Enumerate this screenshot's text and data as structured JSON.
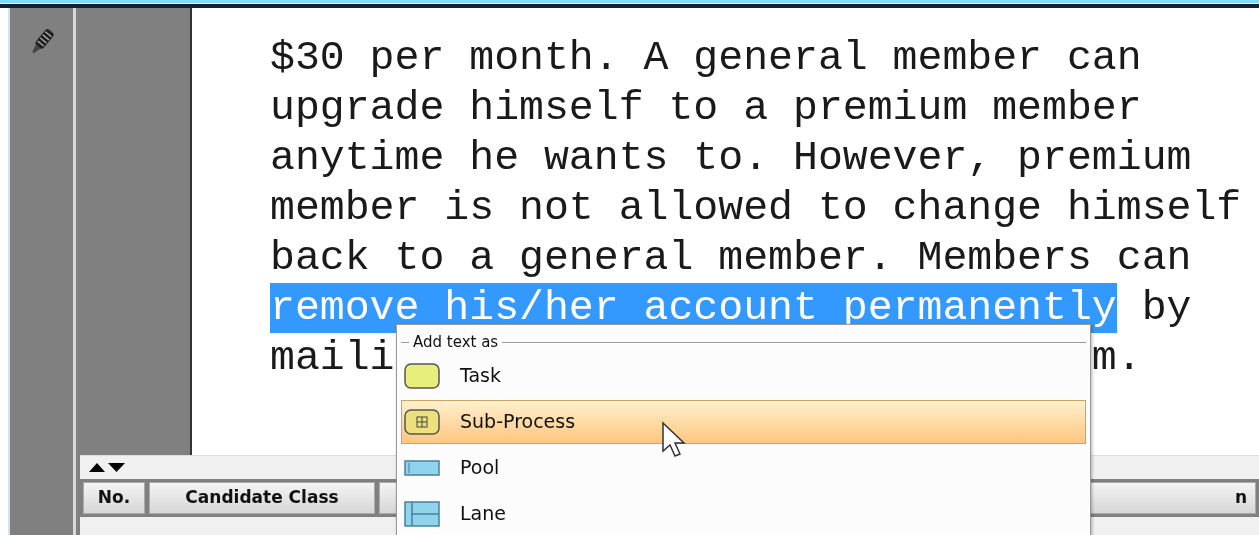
{
  "document": {
    "lines": [
      [
        {
          "text": "$30 per month. A general member can",
          "selected": false
        }
      ],
      [
        {
          "text": "upgrade himself to a premium member",
          "selected": false
        }
      ],
      [
        {
          "text": "anytime he wants to. However, premium",
          "selected": false
        }
      ],
      [
        {
          "text": "member is not allowed to change himself",
          "selected": false
        }
      ],
      [
        {
          "text": "back to a general member. Members can",
          "selected": false
        }
      ],
      [
        {
          "text": "remove his/her account permanently",
          "selected": true
        },
        {
          "text": " by",
          "selected": false
        }
      ],
      [
        {
          "text": "maili",
          "selected": false
        },
        {
          "text": "m.",
          "selected": false
        }
      ]
    ]
  },
  "bottom_panel": {
    "columns": [
      "No.",
      "Candidate Class",
      "n"
    ]
  },
  "context_menu": {
    "title": "Add text as",
    "items": [
      {
        "label": "Task",
        "kind": "task",
        "selected": false
      },
      {
        "label": "Sub-Process",
        "kind": "subprocess",
        "selected": true
      },
      {
        "label": "Pool",
        "kind": "pool",
        "selected": false
      },
      {
        "label": "Lane",
        "kind": "lane",
        "selected": false
      }
    ]
  }
}
